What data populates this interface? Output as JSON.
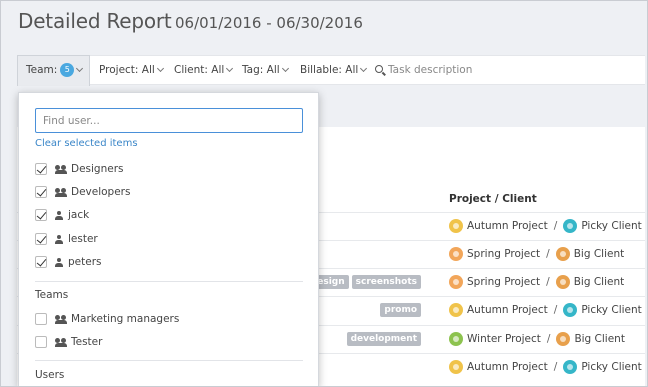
{
  "header": {
    "title": "Detailed Report",
    "date_range": "06/01/2016 - 06/30/2016"
  },
  "filters": {
    "team_label": "Team:",
    "team_count": "5",
    "project": "Project: All",
    "client": "Client: All",
    "tag": "Tag: All",
    "billable": "Billable: All",
    "task_placeholder": "Task description"
  },
  "table": {
    "project_client_header": "Project / Client",
    "rows": [
      {
        "tags": [],
        "project": "Autumn Project",
        "project_color": "#f0c34a",
        "client": "Picky Client",
        "client_color": "#35b6c8"
      },
      {
        "tags": [],
        "project": "Spring Project",
        "project_color": "#f2a65a",
        "client": "Big Client",
        "client_color": "#e8a04c"
      },
      {
        "tags": [
          "esign",
          "screenshots"
        ],
        "project": "Spring Project",
        "project_color": "#f2a65a",
        "client": "Big Client",
        "client_color": "#e8a04c"
      },
      {
        "tags": [
          "promo"
        ],
        "project": "Autumn Project",
        "project_color": "#f0c34a",
        "client": "Picky Client",
        "client_color": "#35b6c8"
      },
      {
        "tags": [
          "development"
        ],
        "project": "Winter Project",
        "project_color": "#8dc34f",
        "client": "Big Client",
        "client_color": "#e8a04c"
      },
      {
        "tags": [],
        "project": "Autumn Project",
        "project_color": "#f0c34a",
        "client": "Picky Client",
        "client_color": "#35b6c8"
      }
    ],
    "separator": "/"
  },
  "dropdown": {
    "search_placeholder": "Find user...",
    "clear_label": "Clear selected items",
    "selected": [
      {
        "label": "Designers",
        "icon": "group-icon",
        "checked": true
      },
      {
        "label": "Developers",
        "icon": "group-icon",
        "checked": true
      },
      {
        "label": "jack",
        "icon": "user-icon",
        "checked": true
      },
      {
        "label": "lester",
        "icon": "user-icon",
        "checked": true
      },
      {
        "label": "peters",
        "icon": "user-icon",
        "checked": true
      }
    ],
    "teams_heading": "Teams",
    "teams": [
      {
        "label": "Marketing managers",
        "icon": "group-icon",
        "checked": false
      },
      {
        "label": "Tester",
        "icon": "group-icon",
        "checked": false
      }
    ],
    "users_heading": "Users"
  },
  "colors": {
    "accent": "#4aa8e0",
    "link": "#3a86c8",
    "tag_bg": "#b8bcc3"
  }
}
